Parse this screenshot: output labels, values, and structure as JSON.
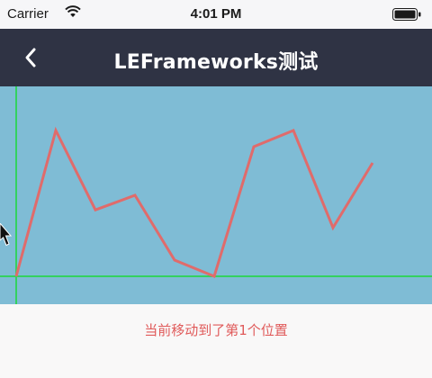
{
  "status_bar": {
    "carrier": "Carrier",
    "time": "4:01 PM",
    "icons": [
      "wifi-icon",
      "battery-icon"
    ]
  },
  "nav": {
    "title": "LEFrameworks测试",
    "back_icon": "chevron-left-icon"
  },
  "colors": {
    "nav_background": "#2f3344",
    "chart_background": "#7fbcd5",
    "line": "#e06b6b",
    "crosshair": "#34d160",
    "status_text": "#e05a5a"
  },
  "chart_data": {
    "type": "line",
    "title": "",
    "xlabel": "",
    "ylabel": "",
    "grid": false,
    "x": [
      0,
      1,
      2,
      3,
      4,
      5,
      6,
      7,
      8,
      9
    ],
    "values": [
      0,
      90,
      41,
      50,
      10,
      0,
      80,
      90,
      30,
      70
    ],
    "ylim": [
      0,
      100
    ],
    "crosshair": {
      "x_index": 0,
      "y_value": 0
    }
  },
  "status": {
    "text": "当前移动到了第1个位置"
  }
}
